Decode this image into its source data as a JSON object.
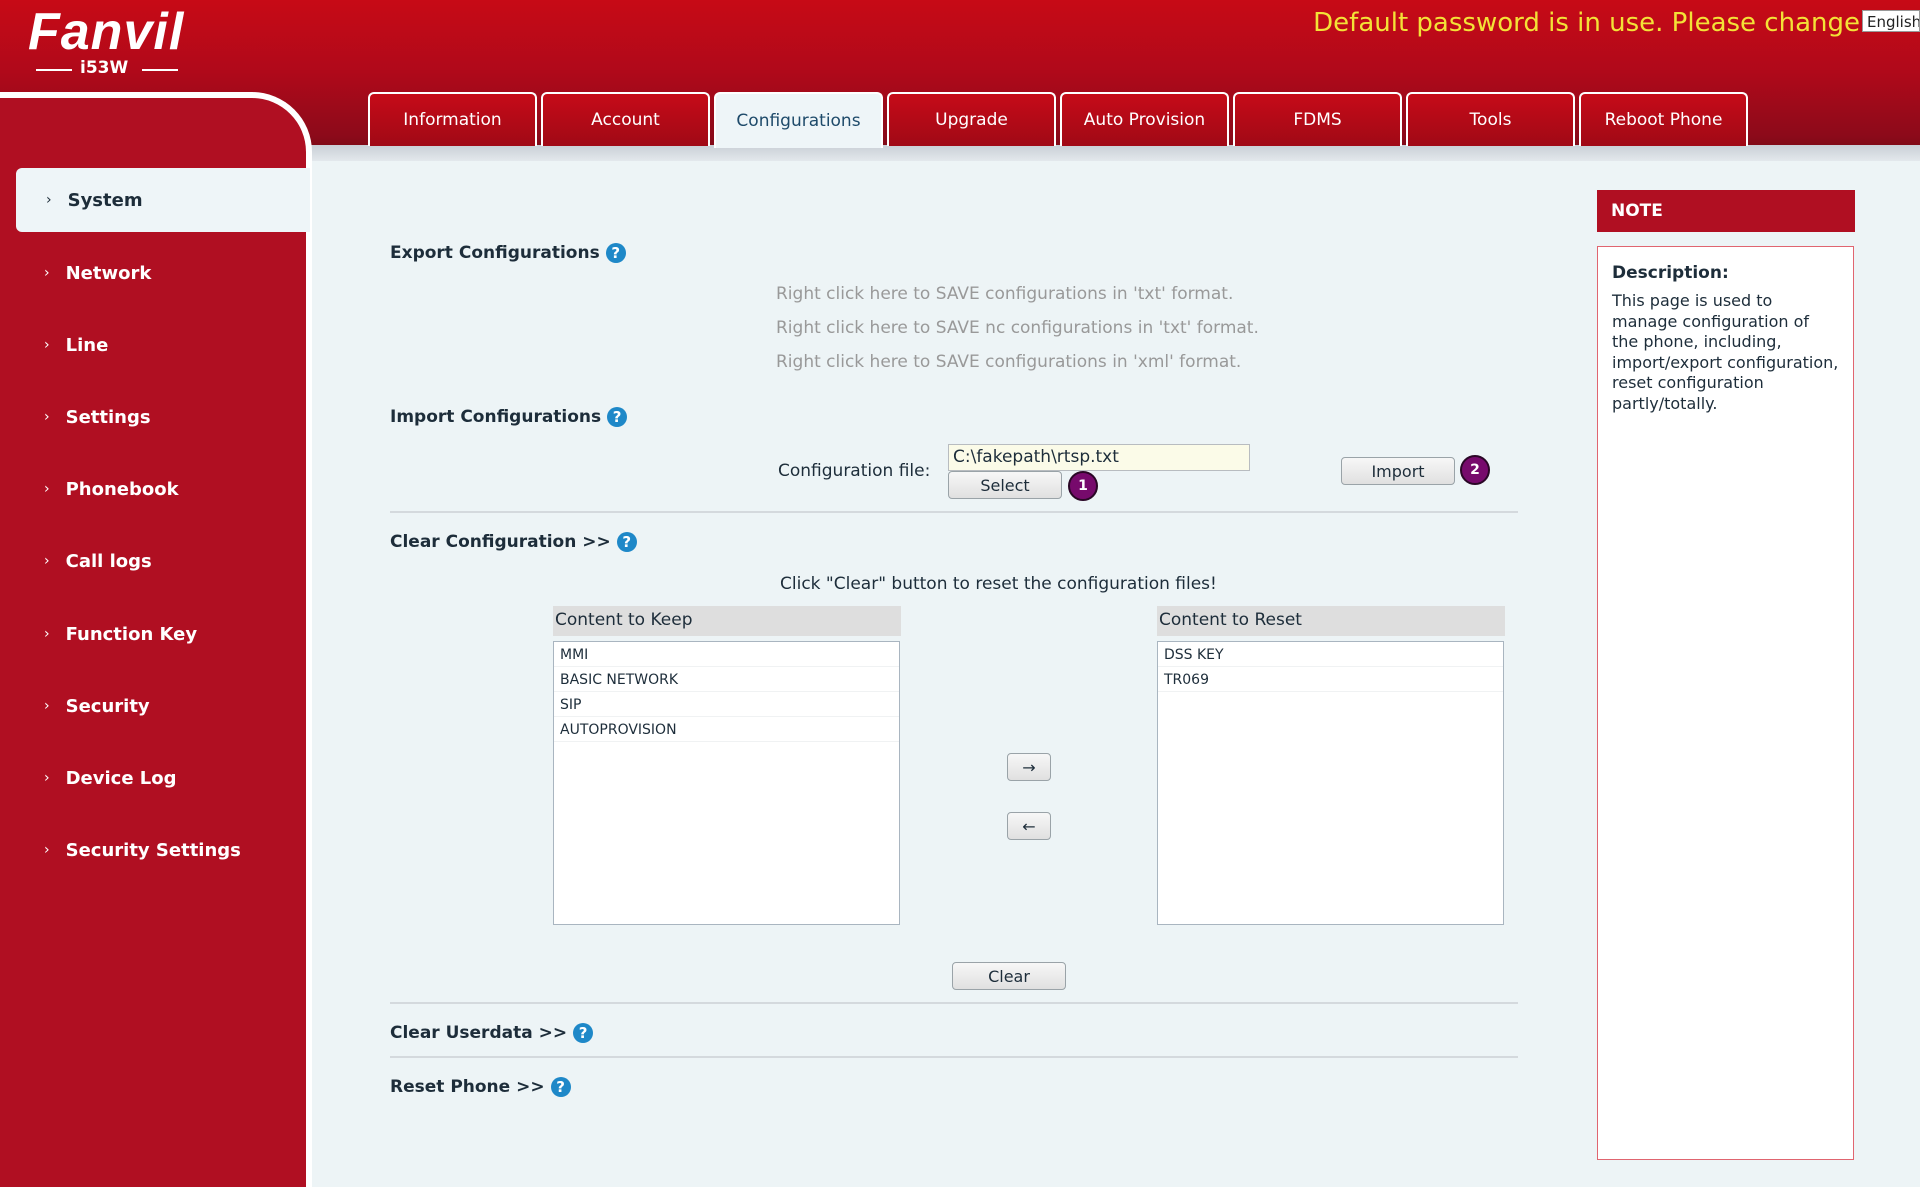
{
  "header": {
    "brand": "Fanvil",
    "model": "i53W",
    "warning": "Default password is in use. Please change",
    "language": "English"
  },
  "tabs": [
    {
      "label": "Information"
    },
    {
      "label": "Account"
    },
    {
      "label": "Configurations"
    },
    {
      "label": "Upgrade"
    },
    {
      "label": "Auto Provision"
    },
    {
      "label": "FDMS"
    },
    {
      "label": "Tools"
    },
    {
      "label": "Reboot Phone"
    }
  ],
  "active_tab": "Configurations",
  "sidebar": {
    "items": [
      {
        "label": "System"
      },
      {
        "label": "Network"
      },
      {
        "label": "Line"
      },
      {
        "label": "Settings"
      },
      {
        "label": "Phonebook"
      },
      {
        "label": "Call logs"
      },
      {
        "label": "Function Key"
      },
      {
        "label": "Security"
      },
      {
        "label": "Device Log"
      },
      {
        "label": "Security Settings"
      }
    ],
    "active": "System"
  },
  "export": {
    "title": "Export Configurations",
    "links": [
      "Right click here to SAVE configurations in 'txt' format.",
      "Right click here to SAVE nc configurations in 'txt' format.",
      "Right click here to SAVE configurations in 'xml' format."
    ]
  },
  "import": {
    "title": "Import Configurations",
    "file_label": "Configuration file:",
    "file_value": "C:\\fakepath\\rtsp.txt",
    "select_label": "Select",
    "import_label": "Import",
    "badge1": "1",
    "badge2": "2"
  },
  "clear_config": {
    "title": "Clear Configuration >>",
    "instruction": "Click \"Clear\" button to reset the configuration files!",
    "keep_header": "Content to Keep",
    "keep_items": [
      "MMI",
      "BASIC NETWORK",
      "SIP",
      "AUTOPROVISION"
    ],
    "reset_header": "Content to Reset",
    "reset_items": [
      "DSS KEY",
      "TR069"
    ],
    "move_right": "→",
    "move_left": "←",
    "clear_label": "Clear"
  },
  "clear_userdata": {
    "title": "Clear Userdata >>"
  },
  "reset_phone": {
    "title": "Reset Phone >>"
  },
  "note": {
    "header": "NOTE",
    "desc_title": "Description:",
    "desc_text": "This page is used to manage configuration of the phone, including, import/export configuration, reset configuration partly/totally."
  },
  "colors": {
    "brand_red": "#b00f22",
    "warning_yellow": "#f3e237",
    "help_blue": "#1e88c8",
    "badge_purple": "#770a6c"
  }
}
